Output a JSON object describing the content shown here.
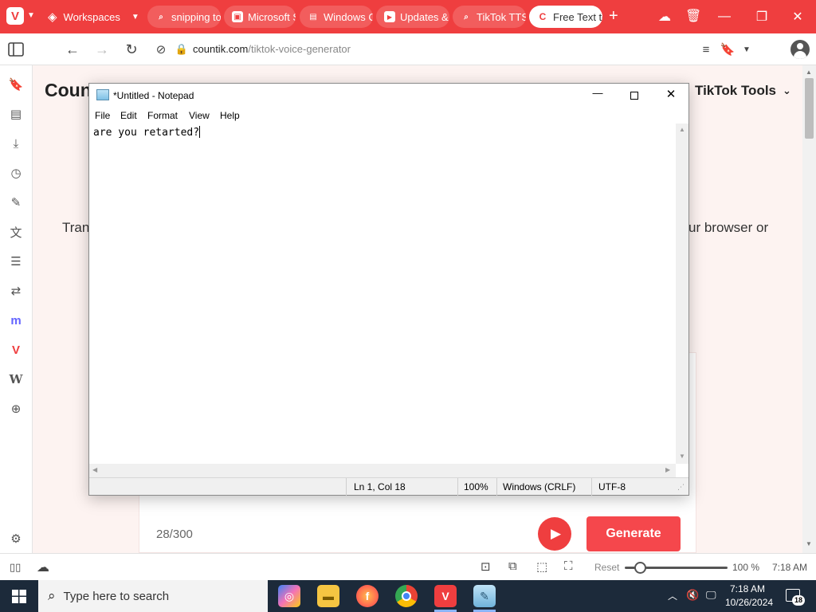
{
  "browser": {
    "workspaces_label": "Workspaces",
    "tabs": [
      {
        "label": "snipping to",
        "icon": "search-icon"
      },
      {
        "label": "Microsoft S",
        "icon": "microsoft-icon"
      },
      {
        "label": "Windows C",
        "icon": "document-icon"
      },
      {
        "label": "Updates &",
        "icon": "youtube-icon"
      },
      {
        "label": "TikTok TTS",
        "icon": "search-icon"
      },
      {
        "label": "Free Text to",
        "icon": "countik-icon"
      }
    ],
    "url_domain": "countik.com",
    "url_path": "/tiktok-voice-generator",
    "accent_color": "#ef3e3f"
  },
  "webpage": {
    "logo_partial": "Coun",
    "nav_tools": "TikTok Tools",
    "left_text_partial": "Tran",
    "right_text_partial": "ur browser or",
    "char_count": "28/300",
    "generate_label": "Generate"
  },
  "notepad": {
    "title": "*Untitled - Notepad",
    "menu": [
      "File",
      "Edit",
      "Format",
      "View",
      "Help"
    ],
    "content": "are you retarted?",
    "status": {
      "position": "Ln 1, Col 18",
      "zoom": "100%",
      "line_ending": "Windows (CRLF)",
      "encoding": "UTF-8"
    }
  },
  "statusbar": {
    "reset_label": "Reset",
    "zoom": "100 %",
    "clock": "7:18 AM",
    "zoom_fraction": 0.15
  },
  "taskbar": {
    "search_placeholder": "Type here to search",
    "time": "7:18 AM",
    "date": "10/26/2024",
    "notification_count": "18"
  }
}
